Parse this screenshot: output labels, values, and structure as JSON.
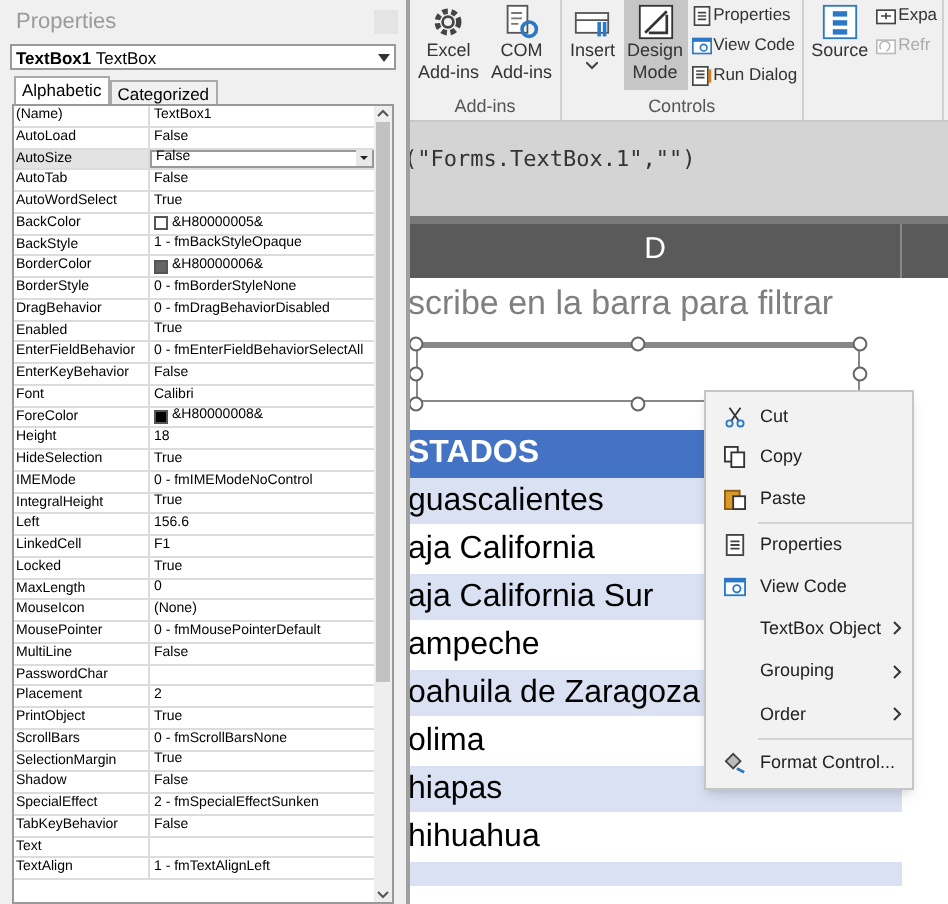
{
  "ribbon": {
    "groups": [
      {
        "label": "Add-ins",
        "items": [
          {
            "kind": "large",
            "lines": [
              "Excel",
              "Add-ins"
            ],
            "selected": false
          },
          {
            "kind": "large",
            "lines": [
              "COM",
              "Add-ins"
            ],
            "selected": false
          }
        ]
      },
      {
        "label": "Controls",
        "items": [
          {
            "kind": "large",
            "lines": [
              "Insert"
            ],
            "caret": true,
            "selected": false
          },
          {
            "kind": "large",
            "lines": [
              "Design",
              "Mode"
            ],
            "selected": true
          },
          {
            "kind": "stack",
            "entries": [
              {
                "label": "Properties",
                "disabled": false
              },
              {
                "label": "View Code",
                "disabled": false
              },
              {
                "label": "Run Dialog",
                "disabled": false
              }
            ]
          }
        ]
      },
      {
        "items": [
          {
            "kind": "large",
            "lines": [
              "Source"
            ],
            "selected": false
          },
          {
            "kind": "stack",
            "entries": [
              {
                "label": "Expa",
                "disabled": false
              },
              {
                "label": "Refr",
                "disabled": true
              }
            ]
          }
        ]
      }
    ]
  },
  "formula": "(\"Forms.TextBox.1\",\"\")",
  "column_header": "D",
  "sheet": {
    "caption": "scribe en la barra para filtrar",
    "table_header": "STADOS",
    "rows": [
      "guascalientes",
      "aja California",
      "aja California Sur",
      "ampeche",
      "oahuila de Zaragoza",
      "olima",
      "hiapas",
      "hihuahua"
    ]
  },
  "properties": {
    "title": "Properties",
    "object": "**TextBox1** TextBox",
    "tabs": [
      {
        "label": "Alphabetic",
        "selected": true
      },
      {
        "label": "Categorized",
        "selected": false
      }
    ],
    "rows": [
      {
        "name": "(Name)",
        "value": "TextBox1",
        "selected": false
      },
      {
        "name": "AutoLoad",
        "value": "False",
        "selected": false
      },
      {
        "name": "AutoSize",
        "value": "False",
        "selected": true
      },
      {
        "name": "AutoTab",
        "value": "False",
        "selected": false
      },
      {
        "name": "AutoWordSelect",
        "value": "True",
        "selected": false
      },
      {
        "name": "BackColor",
        "value": "&H80000005&",
        "color": "#ffffff",
        "selected": false
      },
      {
        "name": "BackStyle",
        "value": "1 - fmBackStyleOpaque",
        "selected": false
      },
      {
        "name": "BorderColor",
        "value": "&H80000006&",
        "color": "#646464",
        "selected": false
      },
      {
        "name": "BorderStyle",
        "value": "0 - fmBorderStyleNone",
        "selected": false
      },
      {
        "name": "DragBehavior",
        "value": "0 - fmDragBehaviorDisabled",
        "selected": false
      },
      {
        "name": "Enabled",
        "value": "True",
        "selected": false
      },
      {
        "name": "EnterFieldBehavior",
        "value": "0 - fmEnterFieldBehaviorSelectAll",
        "selected": false
      },
      {
        "name": "EnterKeyBehavior",
        "value": "False",
        "selected": false
      },
      {
        "name": "Font",
        "value": "Calibri",
        "selected": false
      },
      {
        "name": "ForeColor",
        "value": "&H80000008&",
        "color": "#000000",
        "selected": false
      },
      {
        "name": "Height",
        "value": "18",
        "selected": false
      },
      {
        "name": "HideSelection",
        "value": "True",
        "selected": false
      },
      {
        "name": "IMEMode",
        "value": "0 - fmIMEModeNoControl",
        "selected": false
      },
      {
        "name": "IntegralHeight",
        "value": "True",
        "selected": false
      },
      {
        "name": "Left",
        "value": "156.6",
        "selected": false
      },
      {
        "name": "LinkedCell",
        "value": "F1",
        "selected": false
      },
      {
        "name": "Locked",
        "value": "True",
        "selected": false
      },
      {
        "name": "MaxLength",
        "value": "0",
        "selected": false
      },
      {
        "name": "MouseIcon",
        "value": "(None)",
        "selected": false
      },
      {
        "name": "MousePointer",
        "value": "0 - fmMousePointerDefault",
        "selected": false
      },
      {
        "name": "MultiLine",
        "value": "False",
        "selected": false
      },
      {
        "name": "PasswordChar",
        "selected": false
      },
      {
        "name": "Placement",
        "value": "2",
        "selected": false
      },
      {
        "name": "PrintObject",
        "value": "True",
        "selected": false
      },
      {
        "name": "ScrollBars",
        "value": "0 - fmScrollBarsNone",
        "selected": false
      },
      {
        "name": "SelectionMargin",
        "value": "True",
        "selected": false
      },
      {
        "name": "Shadow",
        "value": "False",
        "selected": false
      },
      {
        "name": "SpecialEffect",
        "value": "2 - fmSpecialEffectSunken",
        "selected": false
      },
      {
        "name": "TabKeyBehavior",
        "value": "False",
        "selected": false
      },
      {
        "name": "Text",
        "selected": false
      },
      {
        "name": "TextAlign",
        "value": "1 - fmTextAlignLeft",
        "selected": false
      }
    ]
  },
  "context_menu": [
    {
      "kind": "item",
      "label": "Cut"
    },
    {
      "kind": "item",
      "label": "Copy"
    },
    {
      "kind": "item",
      "label": "Paste"
    },
    {
      "kind": "separator"
    },
    {
      "kind": "item",
      "label": "Properties"
    },
    {
      "kind": "item",
      "label": "View Code"
    },
    {
      "kind": "submenu",
      "label": "TextBox Object"
    },
    {
      "kind": "submenu",
      "label": "Grouping"
    },
    {
      "kind": "submenu",
      "label": "Order"
    },
    {
      "kind": "separator"
    },
    {
      "kind": "item",
      "label": "Format Control..."
    }
  ]
}
